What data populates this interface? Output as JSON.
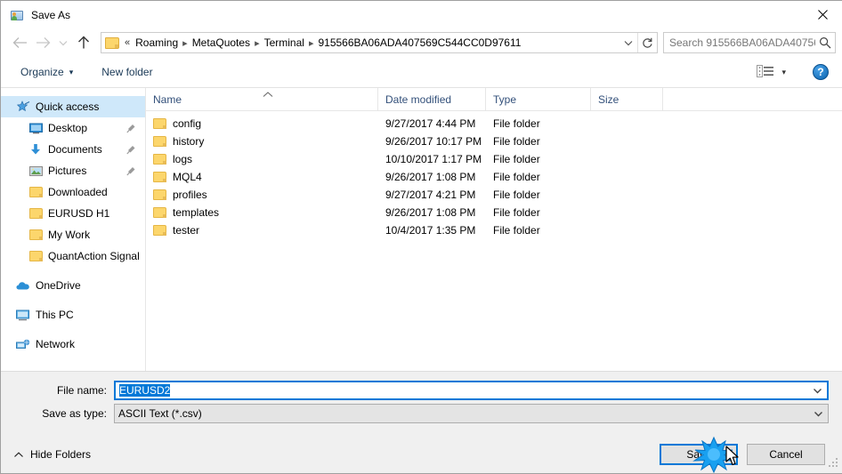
{
  "window": {
    "title": "Save As",
    "icon": "save-as-folder-icon",
    "close_label": "✕"
  },
  "nav": {
    "back": "back-arrow",
    "forward": "forward-arrow",
    "recent": "recent-locations-chevron",
    "up": "up-arrow",
    "breadcrumbs": [
      "Roaming",
      "MetaQuotes",
      "Terminal",
      "915566BA06ADA407569C544CC0D97611"
    ],
    "overflow_marker": "«",
    "dropdown": "chevron-down-icon",
    "refresh": "refresh-icon"
  },
  "search": {
    "placeholder": "Search 915566BA06ADA40756...",
    "value": "",
    "icon": "search-icon"
  },
  "toolbar": {
    "organize_label": "Organize",
    "organize_caret": "▾",
    "new_folder_label": "New folder",
    "view_icon": "list-view-icon",
    "view_caret": "▾",
    "help_label": "?"
  },
  "sidebar": {
    "groups": [
      {
        "header": {
          "label": "Quick access",
          "icon": "star-pin-icon",
          "selected": true
        },
        "items": [
          {
            "label": "Desktop",
            "icon": "desktop-icon",
            "pinned": true
          },
          {
            "label": "Documents",
            "icon": "documents-download-icon",
            "pinned": true
          },
          {
            "label": "Pictures",
            "icon": "pictures-icon",
            "pinned": true
          },
          {
            "label": "Downloaded",
            "icon": "folder-icon",
            "pinned": false
          },
          {
            "label": "EURUSD H1",
            "icon": "folder-icon",
            "pinned": false
          },
          {
            "label": "My Work",
            "icon": "folder-icon",
            "pinned": false
          },
          {
            "label": "QuantAction Signal",
            "icon": "folder-icon",
            "pinned": false
          }
        ]
      },
      {
        "header": {
          "label": "OneDrive",
          "icon": "onedrive-cloud-icon",
          "selected": false
        },
        "items": []
      },
      {
        "header": {
          "label": "This PC",
          "icon": "this-pc-monitor-icon",
          "selected": false
        },
        "items": []
      },
      {
        "header": {
          "label": "Network",
          "icon": "network-icon",
          "selected": false
        },
        "items": []
      }
    ]
  },
  "filelist": {
    "columns": [
      "Name",
      "Date modified",
      "Type",
      "Size"
    ],
    "sort_column": "Name",
    "sort_direction": "ascending",
    "rows": [
      {
        "name": "config",
        "date": "9/27/2017 4:44 PM",
        "type": "File folder",
        "size": ""
      },
      {
        "name": "history",
        "date": "9/26/2017 10:17 PM",
        "type": "File folder",
        "size": ""
      },
      {
        "name": "logs",
        "date": "10/10/2017 1:17 PM",
        "type": "File folder",
        "size": ""
      },
      {
        "name": "MQL4",
        "date": "9/26/2017 1:08 PM",
        "type": "File folder",
        "size": ""
      },
      {
        "name": "profiles",
        "date": "9/27/2017 4:21 PM",
        "type": "File folder",
        "size": ""
      },
      {
        "name": "templates",
        "date": "9/26/2017 1:08 PM",
        "type": "File folder",
        "size": ""
      },
      {
        "name": "tester",
        "date": "10/4/2017 1:35 PM",
        "type": "File folder",
        "size": ""
      }
    ]
  },
  "form": {
    "filename_label": "File name:",
    "filename_value": "EURUSD2",
    "filename_selected": true,
    "filetype_label": "Save as type:",
    "filetype_value": "ASCII Text (*.csv)"
  },
  "footer": {
    "hide_folders_label": "Hide Folders",
    "hide_folders_caret": "⌃",
    "save_label": "Save",
    "cancel_label": "Cancel",
    "default_button": "Save"
  },
  "colors": {
    "accent": "#0078d7",
    "selection": "#cfe8fa",
    "folder": "#fcd66c",
    "dialog_bg": "#f0f0f0",
    "header_text": "#33507a",
    "click_star": "#1e9be9"
  }
}
